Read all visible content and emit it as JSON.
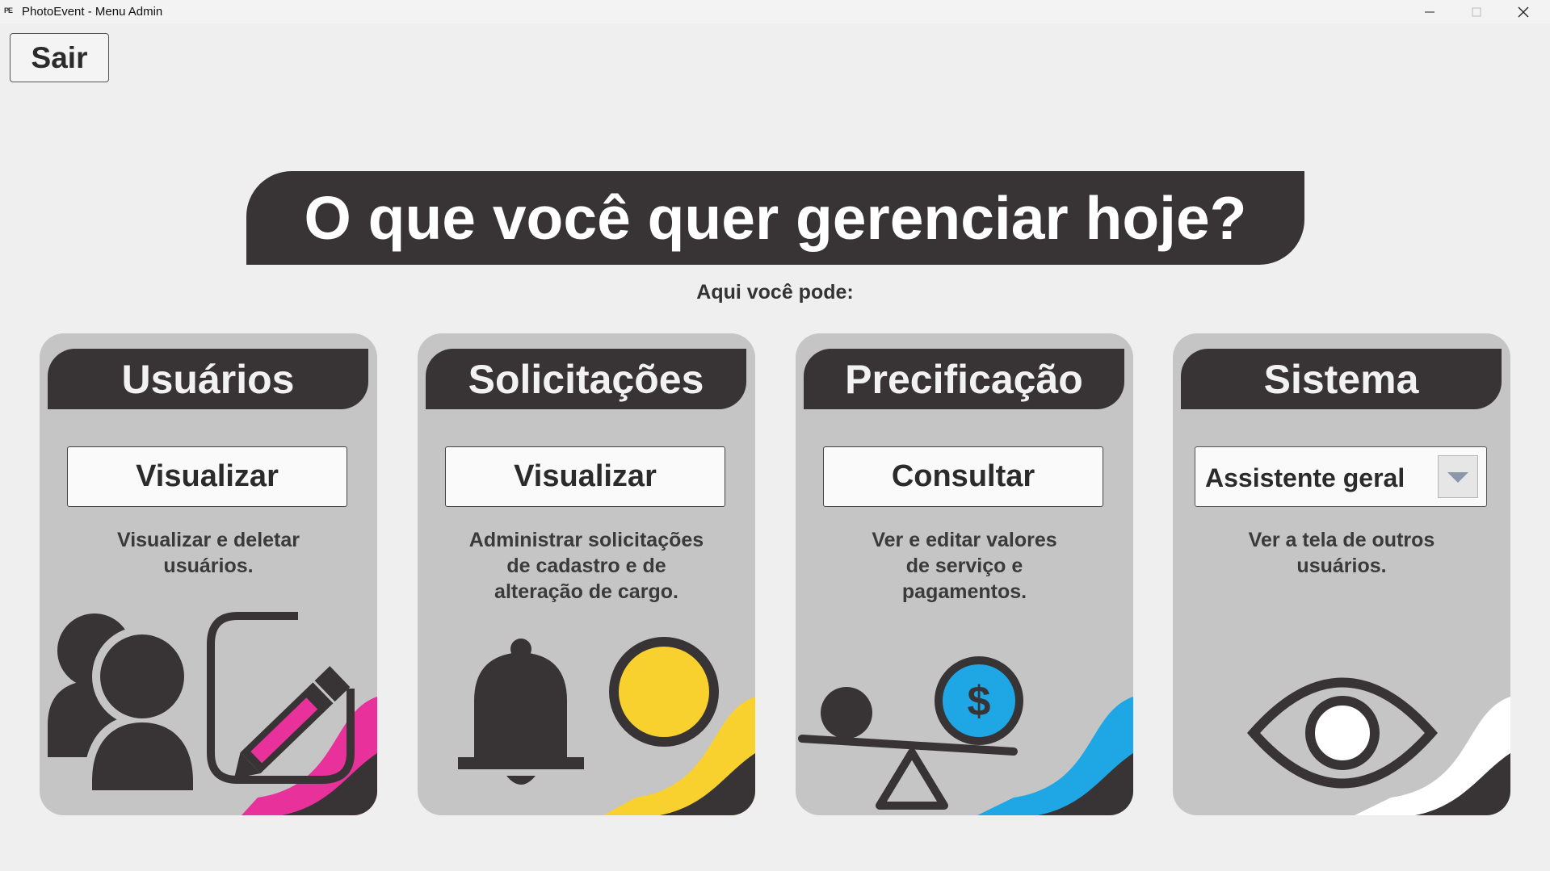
{
  "window": {
    "icon_text": "PE",
    "title": "PhotoEvent - Menu Admin"
  },
  "exit_label": "Sair",
  "heading": "O que você quer gerenciar hoje?",
  "subtitle": "Aqui você pode:",
  "cards": [
    {
      "title": "Usuários",
      "button": "Visualizar",
      "desc": [
        "Visualizar e deletar",
        "usuários."
      ],
      "accent": "#e8319a"
    },
    {
      "title": "Solicitações",
      "button": "Visualizar",
      "desc": [
        "Administrar solicitações",
        "de cadastro e de",
        "alteração de cargo."
      ],
      "accent": "#f8d12f"
    },
    {
      "title": "Precificação",
      "button": "Consultar",
      "desc": [
        "Ver e editar valores",
        "de serviço e",
        "pagamentos."
      ],
      "accent": "#1ea7e4",
      "coin_symbol": "$"
    },
    {
      "title": "Sistema",
      "select_value": "Assistente geral",
      "desc": [
        "Ver a tela de outros",
        "usuários."
      ],
      "accent": "#ffffff"
    }
  ],
  "icons": {
    "card1": [
      "users-icon",
      "edit-icon"
    ],
    "card2": [
      "bell-icon",
      "notification-dot-icon"
    ],
    "card3": [
      "balance-scale-icon",
      "dollar-coin-icon"
    ],
    "card4": [
      "eye-icon"
    ]
  },
  "colors": {
    "dark": "#383435",
    "card_bg": "#c5c5c5",
    "page_bg": "#efefef"
  }
}
